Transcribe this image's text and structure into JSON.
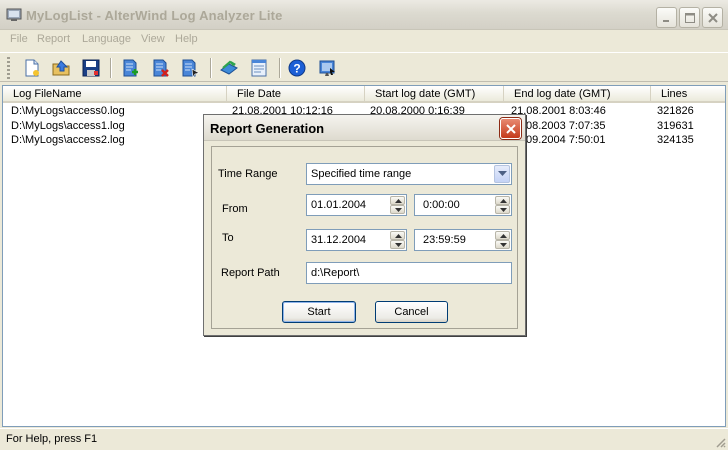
{
  "window": {
    "title": "MyLogList - AlterWind Log Analyzer Lite"
  },
  "menu": [
    "File",
    "Report",
    "Language",
    "View",
    "Help"
  ],
  "toolbar": {
    "icons": [
      "new-document-icon",
      "open-folder-icon",
      "save-disk-icon",
      "add-log-icon",
      "delete-log-icon",
      "log-properties-icon",
      "generate-report-icon",
      "report-settings-icon",
      "help-icon",
      "about-icon"
    ]
  },
  "list": {
    "columns": [
      "Log FileName",
      "File Date",
      "Start log date (GMT)",
      "End log date (GMT)",
      "Lines"
    ],
    "rows": [
      {
        "file": "D:\\MyLogs\\access0.log",
        "file_date": "21.08.2001 10:12:16",
        "start": "20.08.2000 0:16:39",
        "end": "21.08.2001 8:03:46",
        "lines": "321826"
      },
      {
        "file": "D:\\MyLogs\\access1.log",
        "file_date": "",
        "start": "",
        "end": "08.2003 7:07:35",
        "lines": "319631"
      },
      {
        "file": "D:\\MyLogs\\access2.log",
        "file_date": "",
        "start": "",
        "end": "09.2004 7:50:01",
        "lines": "324135"
      }
    ]
  },
  "status": {
    "text": "For Help, press F1"
  },
  "dialog": {
    "title": "Report Generation",
    "time_range_label": "Time Range",
    "time_range_value": "Specified time range",
    "from_label": "From",
    "from_date": "01.01.2004",
    "from_time": "0:00:00",
    "to_label": "To",
    "to_date": "31.12.2004",
    "to_time": "23:59:59",
    "path_label": "Report Path",
    "path_value": "d:\\Report\\",
    "start_label": "Start",
    "cancel_label": "Cancel"
  },
  "colors": {
    "accent_close": "#c4391b",
    "field_border": "#7f9db9",
    "inactive_title_text": "#aca899"
  }
}
